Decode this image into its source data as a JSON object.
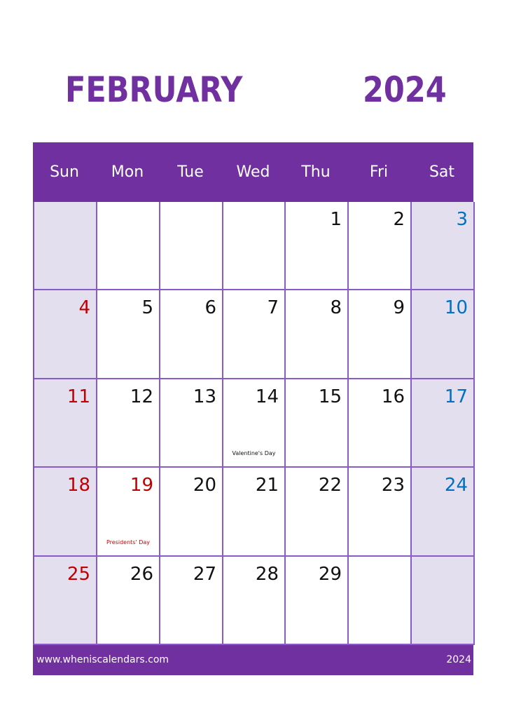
{
  "title": {
    "month": "FEBRUARY",
    "year": "2024"
  },
  "weekdays": [
    "Sun",
    "Mon",
    "Tue",
    "Wed",
    "Thu",
    "Fri",
    "Sat"
  ],
  "colors": {
    "accent": "#7030a0",
    "weekend_bg": "#e4dfee",
    "sunday": "#c00000",
    "saturday": "#0070c0",
    "holiday": "#c00000"
  },
  "weeks": [
    [
      {
        "day": ""
      },
      {
        "day": ""
      },
      {
        "day": ""
      },
      {
        "day": ""
      },
      {
        "day": "1"
      },
      {
        "day": "2"
      },
      {
        "day": "3"
      }
    ],
    [
      {
        "day": "4"
      },
      {
        "day": "5"
      },
      {
        "day": "6"
      },
      {
        "day": "7"
      },
      {
        "day": "8"
      },
      {
        "day": "9"
      },
      {
        "day": "10"
      }
    ],
    [
      {
        "day": "11"
      },
      {
        "day": "12"
      },
      {
        "day": "13"
      },
      {
        "day": "14",
        "event": "Valentine's Day"
      },
      {
        "day": "15"
      },
      {
        "day": "16"
      },
      {
        "day": "17"
      }
    ],
    [
      {
        "day": "18"
      },
      {
        "day": "19",
        "event": "Presidents' Day",
        "holiday": true
      },
      {
        "day": "20"
      },
      {
        "day": "21"
      },
      {
        "day": "22"
      },
      {
        "day": "23"
      },
      {
        "day": "24"
      }
    ],
    [
      {
        "day": "25"
      },
      {
        "day": "26"
      },
      {
        "day": "27"
      },
      {
        "day": "28"
      },
      {
        "day": "29"
      },
      {
        "day": ""
      },
      {
        "day": ""
      }
    ]
  ],
  "footer": {
    "website": "www.wheniscalendars.com",
    "year": "2024"
  }
}
